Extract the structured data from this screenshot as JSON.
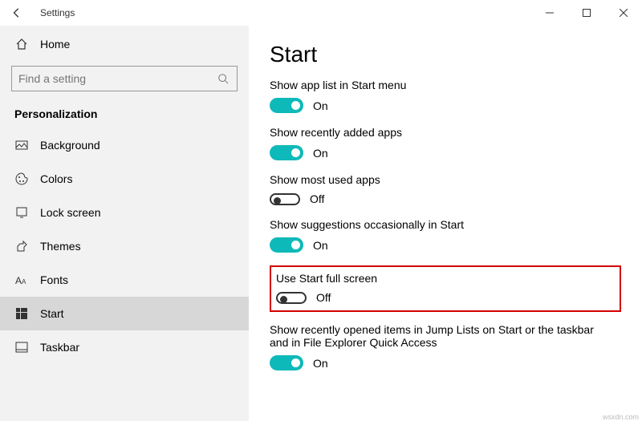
{
  "window": {
    "title": "Settings"
  },
  "sidebar": {
    "home": "Home",
    "search_placeholder": "Find a setting",
    "category": "Personalization",
    "items": [
      {
        "label": "Background"
      },
      {
        "label": "Colors"
      },
      {
        "label": "Lock screen"
      },
      {
        "label": "Themes"
      },
      {
        "label": "Fonts"
      },
      {
        "label": "Start"
      },
      {
        "label": "Taskbar"
      }
    ]
  },
  "page": {
    "title": "Start",
    "settings": [
      {
        "label": "Show app list in Start menu",
        "state": "On"
      },
      {
        "label": "Show recently added apps",
        "state": "On"
      },
      {
        "label": "Show most used apps",
        "state": "Off"
      },
      {
        "label": "Show suggestions occasionally in Start",
        "state": "On"
      },
      {
        "label": "Use Start full screen",
        "state": "Off"
      },
      {
        "label": "Show recently opened items in Jump Lists on Start or the taskbar and in File Explorer Quick Access",
        "state": "On"
      }
    ]
  },
  "watermark": "wsxdn.com"
}
